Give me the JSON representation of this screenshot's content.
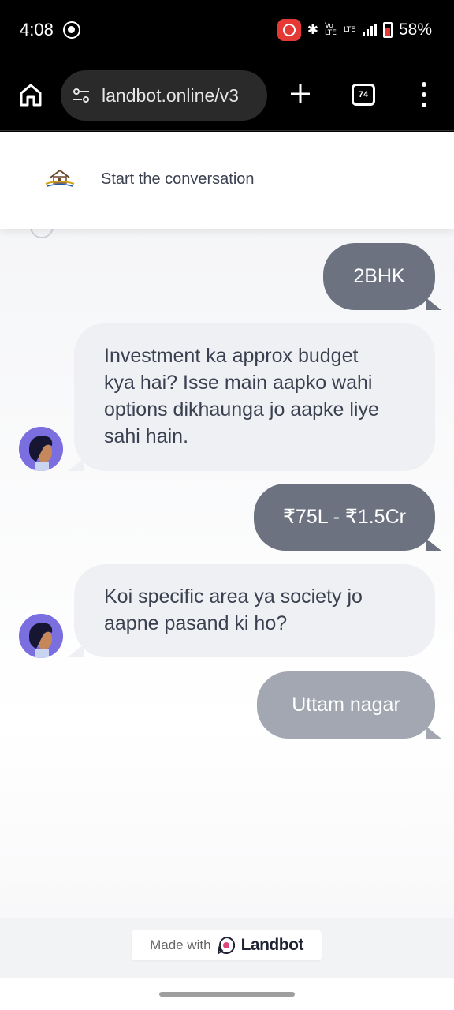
{
  "status_bar": {
    "time": "4:08",
    "network": "LTE",
    "battery": "58%"
  },
  "browser": {
    "url": "landbot.online/v3",
    "tab_count": "74"
  },
  "chat": {
    "header_title": "Start the conversation",
    "messages": [
      {
        "sender": "user",
        "text": "2BHK"
      },
      {
        "sender": "bot",
        "lines": [
          "Investment ka approx budget",
          "kya hai? Isse main aapko wahi",
          "options dikhaunga jo aapke liye",
          "sahi hain."
        ]
      },
      {
        "sender": "user",
        "text": "₹75L - ₹1.5Cr"
      },
      {
        "sender": "bot",
        "lines": [
          "Koi specific area ya society jo",
          "aapne pasand ki ho?"
        ]
      },
      {
        "sender": "user",
        "text": "Uttam nagar",
        "state": "pending"
      }
    ]
  },
  "footer": {
    "made_with": "Made with",
    "brand": "Landbot"
  },
  "colors": {
    "user_bubble": "#6c727f",
    "user_bubble_pending": "#a3a7b1",
    "bot_bubble": "#eef0f3",
    "avatar_bg": "#7b6fe0"
  }
}
